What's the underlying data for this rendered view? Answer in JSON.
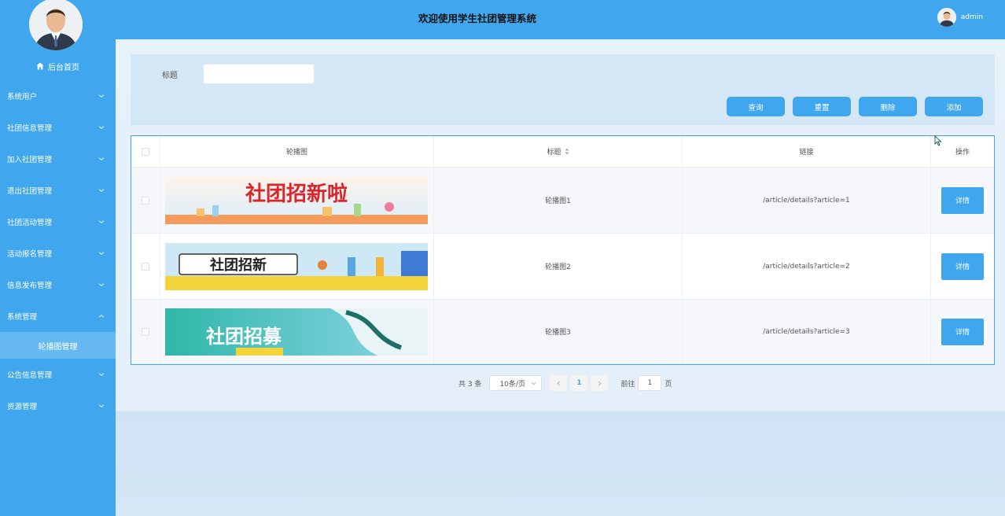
{
  "sidebar": {
    "home_label": "后台首页",
    "items": [
      {
        "label": "系统用户"
      },
      {
        "label": "社团信息管理"
      },
      {
        "label": "加入社团管理"
      },
      {
        "label": "退出社团管理"
      },
      {
        "label": "社团活动管理"
      },
      {
        "label": "活动报名管理"
      },
      {
        "label": "信息发布管理"
      },
      {
        "label": "系统管理"
      }
    ],
    "active_sub_item": "轮播图管理",
    "items_after": [
      {
        "label": "公告信息管理"
      },
      {
        "label": "资源管理"
      }
    ]
  },
  "header": {
    "title": "欢迎使用学生社团管理系统",
    "username": "admin"
  },
  "search": {
    "title_label": "标题",
    "title_value": "",
    "buttons": {
      "query": "查询",
      "reset": "重置",
      "delete": "删除",
      "add": "添加"
    }
  },
  "table": {
    "columns": {
      "image": "轮播图",
      "title": "标题",
      "link": "链接",
      "actions": "操作"
    },
    "rows": [
      {
        "title": "轮播图1",
        "link": "/article/details?article=1",
        "action": "详情",
        "banner_text": "社团招新啦"
      },
      {
        "title": "轮播图2",
        "link": "/article/details?article=2",
        "action": "详情",
        "banner_text": "社团招新"
      },
      {
        "title": "轮播图3",
        "link": "/article/details?article=3",
        "action": "详情",
        "banner_text": "社团招募"
      }
    ]
  },
  "pagination": {
    "total": "共 3 条",
    "page_size": "10条/页",
    "current_page": "1",
    "goto_label": "前往",
    "goto_value": "1",
    "page_suffix": "页"
  },
  "colors": {
    "primary": "#40a7ee",
    "background": "#e6f0f9"
  }
}
